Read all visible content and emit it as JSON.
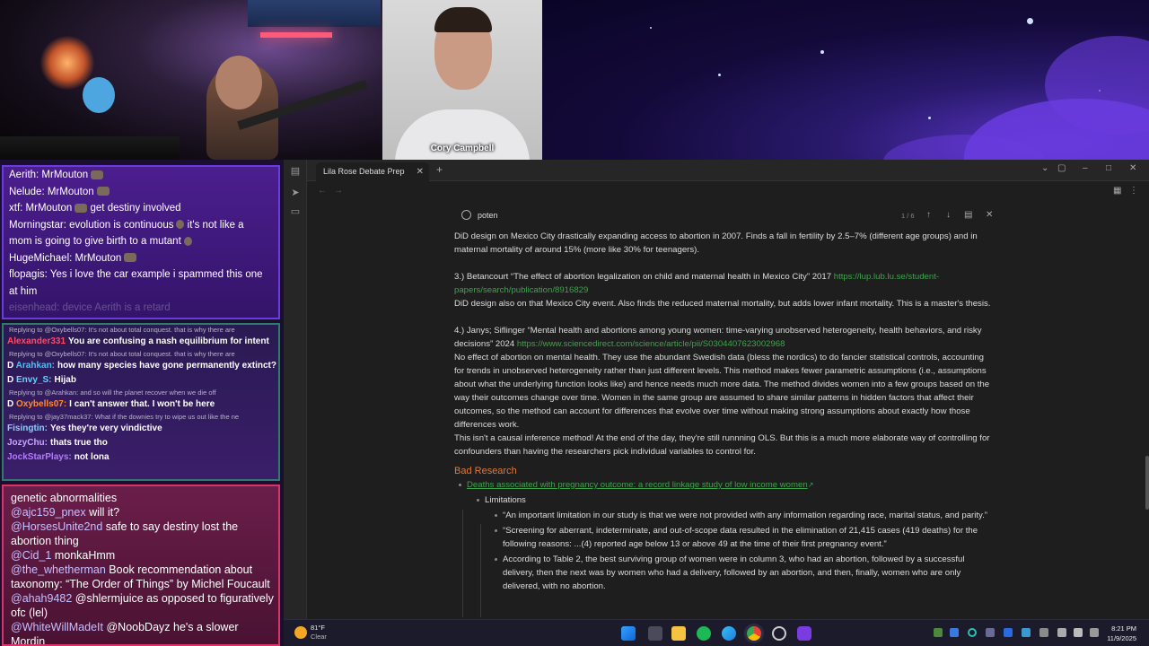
{
  "stream": {
    "guest_name": "Cory Campbell"
  },
  "chat_top": [
    {
      "user": "Aerith",
      "msg": ": MrMouton"
    },
    {
      "user": "Nelude",
      "msg": ": MrMouton"
    },
    {
      "user": "xtf",
      "msg": ": MrMouton",
      "msg2": " get destiny involved"
    },
    {
      "user": "Morningstar",
      "msg": ": evolution is continuous",
      "msg2": " it's not like a"
    },
    {
      "user": "",
      "msg": "mom is going to give birth to a mutant"
    },
    {
      "user": "HugeMichael",
      "msg": ": MrMouton"
    },
    {
      "user": "flopagis",
      "msg": ": Yes i love the car example i spammed this one"
    },
    {
      "user": "",
      "msg": "at him"
    },
    {
      "user": "",
      "msg": "eisenhead: device Aerith is a retard"
    }
  ],
  "chat_mid": [
    {
      "reply": "Replying to @Oxybells07: It's not about total conquest. that is why there are"
    },
    {
      "user": "Alexander331",
      "msg": "You are confusing a nash equilibrium for intent",
      "color": "#ff4a6a"
    },
    {
      "reply": "Replying to @Oxybells07: It's not about total conquest. that is why there are"
    },
    {
      "user": "Arahkan:",
      "msg": "how many species have gone permanently extinct?",
      "color": "#3ec6ff",
      "prefix": "D"
    },
    {
      "user": "Envy_S:",
      "msg": "Hijab",
      "color": "#6ad0ff",
      "prefix": "D"
    },
    {
      "reply": "Replying to @Arahkan: and so will the planet recover when we die off"
    },
    {
      "user": "Oxybells07:",
      "msg": "I can't answer that. I won't be here",
      "color": "#ff8a3a",
      "prefix": "D"
    },
    {
      "reply": "Replying to @jay37mack37: What if the downies try to wipe us out like the ne"
    },
    {
      "user": "Fisingtin:",
      "msg": "Yes they're very vindictive",
      "color": "#8ad0ff"
    },
    {
      "user": "JozyChu:",
      "msg": "thats true tho",
      "color": "#c9a6ff"
    },
    {
      "user": "JockStarPlays:",
      "msg": "not lona",
      "color": "#b47aff"
    }
  ],
  "chat_bottom": [
    {
      "user": "",
      "msg": "genetic abnormalities"
    },
    {
      "user": "@ajc159_pnex",
      "msg": " will it?"
    },
    {
      "user": "@HorsesUnite2nd",
      "msg": " safe to say destiny lost the abortion thing"
    },
    {
      "user": "@Cid_1",
      "msg": " monkaHmm"
    },
    {
      "user": "@the_whetherman",
      "msg": " Book recommendation about taxonomy: “The Order of Things” by Michel Foucault"
    },
    {
      "user": "@ahah9482",
      "msg": " @shlermjuice as opposed to figuratively ofc (lel)"
    },
    {
      "user": "@WhiteWillMadeIt",
      "msg": " @NoobDayz he's a slower Mordin"
    }
  ],
  "app": {
    "tab_title": "Lila Rose Debate Prep",
    "search_query": "poten",
    "search_count": "1 / 6"
  },
  "doc": {
    "p1": "DiD design on Mexico City drastically expanding access to abortion in 2007. Finds a fall in fertility by 2.5–7% (different age groups) and in maternal mortality of around 15% (more like 30% for teenagers).",
    "p2_text": "3.) Betancourt “The effect of abortion legalization on child and maternal health in Mexico City” 2017 ",
    "p2_link": "https://lup.lub.lu.se/student-papers/search/publication/8916829",
    "p3": "DiD design also on that Mexico City event. Also finds the reduced maternal mortality, but adds lower infant mortality. This is a master's thesis.",
    "p4_text": "4.) Janys; Siflinger “Mental health and abortions among young women: time-varying unobserved heterogeneity, health behaviors, and risky decisions” 2024 ",
    "p4_link": "https://www.sciencedirect.com/science/article/pii/S0304407623002968",
    "p5": "No effect of abortion on mental health. They use the abundant Swedish data (bless the nordics) to do fancier statistical controls, accounting for trends in unobserved heterogeneity rather than just different levels. This method makes fewer parametric assumptions (i.e., assumptions about what the underlying function looks like) and hence needs much more data. The method divides women into a few groups based on the way their outcomes change over time. Women in the same group are assumed to share similar patterns in hidden factors that affect their outcomes, so the method can account for differences that evolve over time without making strong assumptions about exactly how those differences work.",
    "p6": "This isn't a causal inference method! At the end of the day, they're still runnning OLS. But this is a much more elaborate way of controlling for confounders than having the researchers pick individual variables to control for.",
    "heading": "Bad Research",
    "bullet_link": "Deaths associated with pregnancy outcome: a record linkage study of low income women",
    "limitations": "Limitations",
    "q1": "“An important limitation in our study is that we were not provided with any information regarding race, marital status, and parity.”",
    "q2": "“Screening for aberrant, indeterminate, and out-of-scope data resulted in the elimination of 21,415 cases (419 deaths) for the following reasons: ...(4) reported age below 13 or above 49 at the time of their first pregnancy event.”",
    "q3": "According to Table 2, the best surviving group of women were in column 3, who had an abortion, followed by a successful delivery, then the next was by women who had a delivery, followed by an abortion, and then, finally, women who are only delivered, with no abortion."
  },
  "taskbar": {
    "temp": "81°F",
    "condition": "Clear",
    "time": "8:21 PM",
    "date": "11/9/2025"
  }
}
